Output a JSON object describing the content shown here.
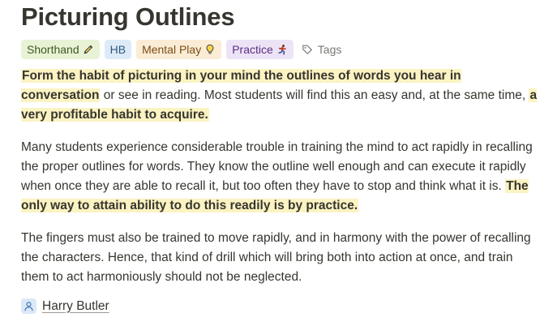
{
  "page": {
    "title": "Picturing Outlines"
  },
  "tags": [
    {
      "label": "Shorthand",
      "icon": "pencil-icon",
      "color": "#e8f3d6"
    },
    {
      "label": "HB",
      "icon": "",
      "color": "#ddebf8"
    },
    {
      "label": "Mental Play",
      "icon": "lightbulb-icon",
      "color": "#fbecd6"
    },
    {
      "label": "Practice",
      "icon": "runner-icon",
      "color": "#ede3f7"
    }
  ],
  "tags_button": {
    "label": "Tags",
    "icon": "tag-icon"
  },
  "paragraphs": [
    {
      "hl1": "Form the habit of picturing in your mind the outlines of words you hear in conversation",
      "text1": " or see in reading. Most students will find this an easy and, at the same time, ",
      "hl2": "a very profitable habit to acquire."
    },
    {
      "text1": "Many students experience considerable trouble in training the mind to act rapidly in recalling the proper outlines for words. They know the outline well enough and can execute it rapidly when once they are able to recall it, but too often they have to stop and think what it is. ",
      "hl1": "The only way to attain ability to do this readily is by practice."
    },
    {
      "text1": "The fingers must also be trained to move rapidly, and in harmony with the power of recalling the characters. Hence, that kind of drill which will bring both into action at once, and train them to act harmoniously should not be neglected."
    }
  ],
  "author": {
    "name": "Harry Butler",
    "icon": "person-icon"
  }
}
